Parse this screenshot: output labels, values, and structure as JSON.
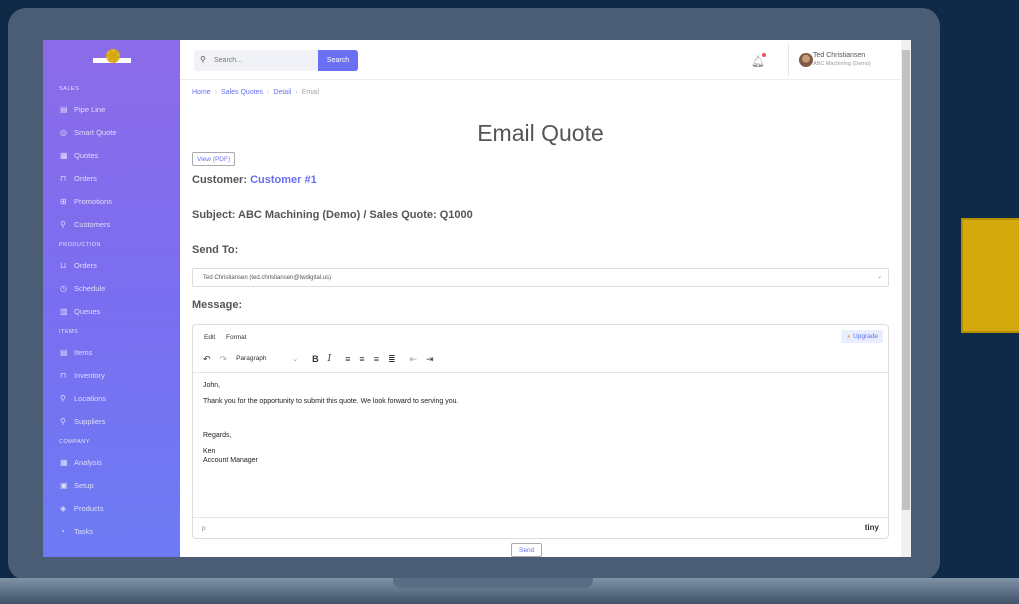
{
  "sidebar": {
    "sections": [
      {
        "label": "SALES",
        "items": [
          {
            "label": "Pipe Line",
            "icon": "pipeline-icon",
            "glyph": "▤"
          },
          {
            "label": "Smart Quote",
            "icon": "smart-quote-icon",
            "glyph": "◎"
          },
          {
            "label": "Quotes",
            "icon": "quotes-icon",
            "glyph": "▦"
          },
          {
            "label": "Orders",
            "icon": "orders-icon",
            "glyph": "⊓"
          },
          {
            "label": "Promotions",
            "icon": "promotions-icon",
            "glyph": "⊞"
          },
          {
            "label": "Customers",
            "icon": "customers-icon",
            "glyph": "⚲"
          }
        ]
      },
      {
        "label": "PRODUCTION",
        "items": [
          {
            "label": "Orders",
            "icon": "production-orders-icon",
            "glyph": "⊔"
          },
          {
            "label": "Schedule",
            "icon": "schedule-icon",
            "glyph": "◷"
          },
          {
            "label": "Queues",
            "icon": "queues-icon",
            "glyph": "▥"
          }
        ]
      },
      {
        "label": "ITEMS",
        "items": [
          {
            "label": "Items",
            "icon": "items-icon",
            "glyph": "▤"
          },
          {
            "label": "Inventory",
            "icon": "inventory-icon",
            "glyph": "⊓"
          },
          {
            "label": "Locations",
            "icon": "locations-icon",
            "glyph": "⚲"
          },
          {
            "label": "Suppliers",
            "icon": "suppliers-icon",
            "glyph": "⚲"
          }
        ]
      },
      {
        "label": "COMPANY",
        "items": [
          {
            "label": "Analysis",
            "icon": "analysis-icon",
            "glyph": "▦"
          },
          {
            "label": "Setup",
            "icon": "setup-icon",
            "glyph": "▣"
          },
          {
            "label": "Products",
            "icon": "products-icon",
            "glyph": "◈"
          },
          {
            "label": "Tasks",
            "icon": "tasks-icon",
            "glyph": "◔"
          }
        ]
      }
    ]
  },
  "topbar": {
    "search_placeholder": "Search...",
    "search_button": "Search",
    "user_name": "Ted Christiansen",
    "user_org": "ABC Machining (Demo)"
  },
  "breadcrumb": {
    "items": [
      "Home",
      "Sales Quotes",
      "Detail"
    ],
    "current": "Email"
  },
  "page": {
    "title": "Email Quote",
    "view_pdf": "View (PDF)",
    "customer_label": "Customer:",
    "customer_value": "Customer #1",
    "subject": "Subject: ABC Machining (Demo) / Sales Quote: Q1000",
    "send_to_label": "Send To:",
    "send_to_value": "Ted Christiansen (ted.christiansen@twdigital.us)",
    "message_label": "Message:",
    "send_button": "Send"
  },
  "editor": {
    "menu": [
      "Edit",
      "Format"
    ],
    "upgrade_label": "Upgrade",
    "block_format": "Paragraph",
    "body_lines": [
      "John,",
      "Thank you for the opportunity to submit this quote.  We look forward to serving you.",
      "",
      "",
      "Regards,",
      "Ken",
      "Account Manager"
    ],
    "status_path": "p",
    "brand": "tiny"
  },
  "colors": {
    "accent": "#6a6ff4",
    "sidebar_top": "#8c6be8",
    "sidebar_bottom": "#6c7bf3",
    "notification_dot": "#e6524f"
  }
}
